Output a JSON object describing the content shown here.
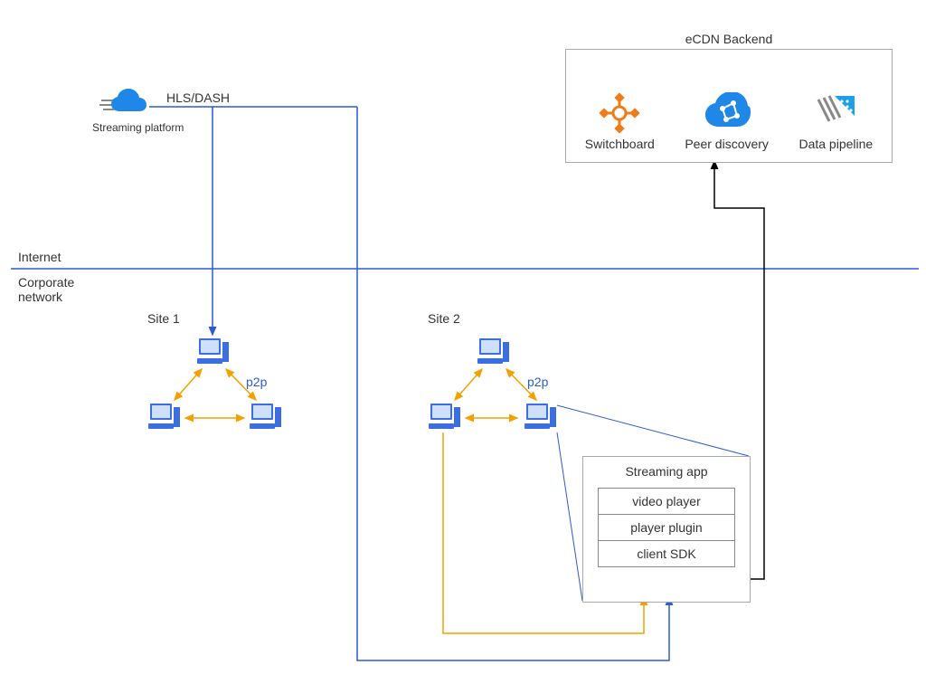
{
  "labels": {
    "internet": "Internet",
    "corporate": "Corporate network",
    "streaming_platform": "Streaming platform",
    "hls": "HLS/DASH",
    "site1": "Site 1",
    "site2": "Site 2",
    "p2p1": "p2p",
    "p2p2": "p2p"
  },
  "ecdn": {
    "title": "eCDN Backend",
    "switchboard": "Switchboard",
    "peer_discovery": "Peer discovery",
    "data_pipeline": "Data pipeline"
  },
  "app": {
    "title": "Streaming app",
    "video_player": "video player",
    "player_plugin": "player plugin",
    "client_sdk": "client SDK"
  },
  "colors": {
    "blue": "#2b5cd1",
    "orange": "#f2a100",
    "black": "#000"
  }
}
